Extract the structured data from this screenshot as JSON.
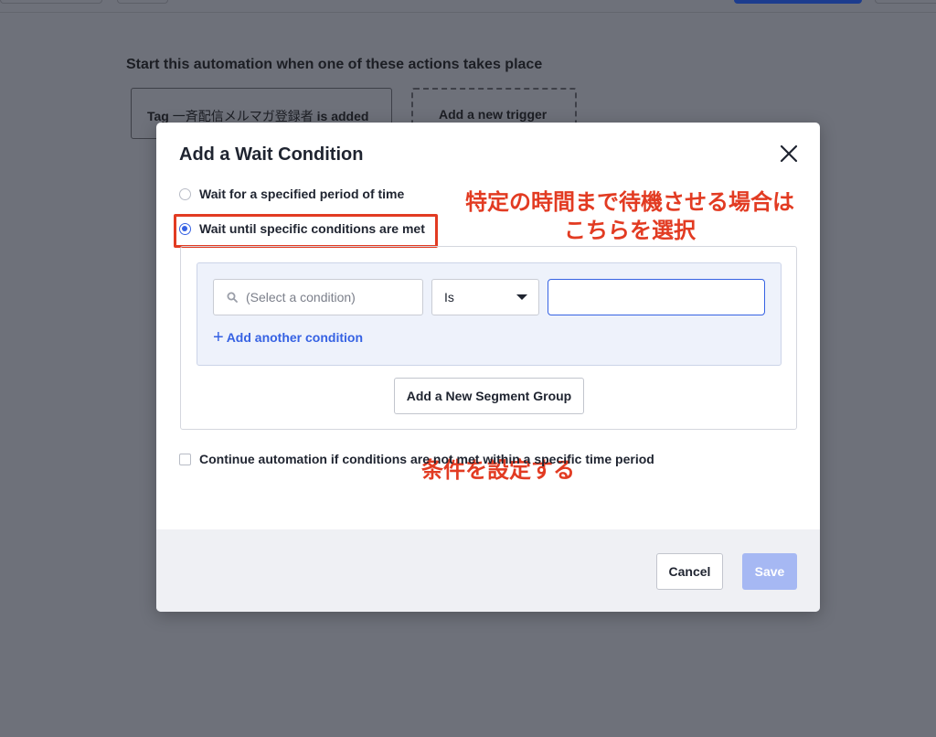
{
  "background": {
    "heading": "Start this automation when one of these actions takes place",
    "trigger": {
      "prefix": "Tag ",
      "tag_name": "一斉配信メルマガ登録者",
      "suffix": " is added"
    },
    "add_trigger_label": "Add a new trigger"
  },
  "modal": {
    "title": "Add a Wait Condition",
    "options": [
      {
        "label": "Wait for a specified period of time",
        "selected": false
      },
      {
        "label": "Wait until specific conditions are met",
        "selected": true
      }
    ],
    "condition_input": {
      "placeholder": "(Select a condition)"
    },
    "operator_select": {
      "value": "Is"
    },
    "value_input": {
      "value": ""
    },
    "add_condition_label": "Add another condition",
    "add_segment_group_label": "Add a New Segment Group",
    "continue_checkbox": {
      "label": "Continue automation if conditions are not met within a specific time period",
      "checked": false
    },
    "footer": {
      "cancel_label": "Cancel",
      "save_label": "Save"
    }
  },
  "annotations": {
    "option_note_line1": "特定の時間まで待機させる場合は",
    "option_note_line2": "こちらを選択",
    "condition_note": "条件を設定する"
  },
  "colors": {
    "accent": "#3662e3",
    "annotation": "#e23b22",
    "save_disabled": "#a6b8f3"
  }
}
